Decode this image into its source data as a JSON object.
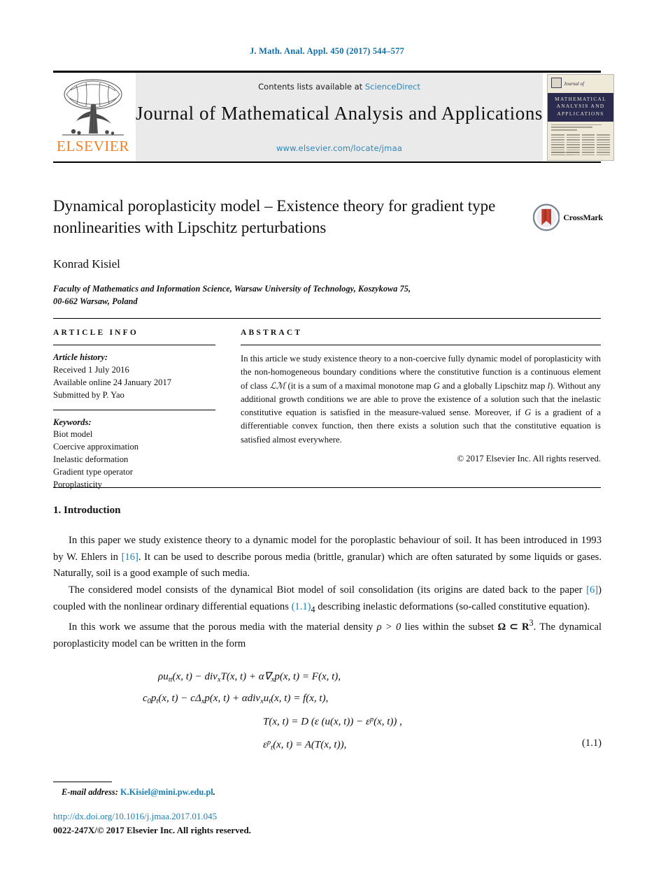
{
  "running_head": "J. Math. Anal. Appl. 450 (2017) 544–577",
  "masthead": {
    "contents_prefix": "Contents lists available at ",
    "sciencedirect": "ScienceDirect",
    "journal_title": "Journal of Mathematical Analysis and Applications",
    "journal_url": "www.elsevier.com/locate/jmaa",
    "publisher_wordmark": "ELSEVIER",
    "cover": {
      "journal_of": "Journal of",
      "band_line1": "MATHEMATICAL",
      "band_line2": "ANALYSIS AND",
      "band_line3": "APPLICATIONS"
    }
  },
  "article": {
    "title": "Dynamical poroplasticity model – Existence theory for gradient type nonlinearities with Lipschitz perturbations",
    "author": "Konrad Kisiel",
    "affiliation_line1": "Faculty of Mathematics and Information Science, Warsaw University of Technology, Koszykowa 75,",
    "affiliation_line2": "00-662 Warsaw, Poland",
    "crossmark_label": "CrossMark"
  },
  "info": {
    "heading": "ARTICLE INFO",
    "history_label": "Article history:",
    "history": [
      "Received 1 July 2016",
      "Available online 24 January 2017",
      "Submitted by P. Yao"
    ],
    "keywords_label": "Keywords:",
    "keywords": [
      "Biot model",
      "Coercive approximation",
      "Inelastic deformation",
      "Gradient type operator",
      "Poroplasticity"
    ]
  },
  "abstract": {
    "heading": "ABSTRACT",
    "part1": "In this article we study existence theory to a non-coercive fully dynamic model of poroplasticity with the non-homogeneous boundary conditions where the constitutive function is a continuous element of class ",
    "class_symbol": "ℒℳ",
    "part2": " (it is a sum of a maximal monotone map ",
    "sym_G": "G",
    "part3": " and a globally Lipschitz map ",
    "sym_l": "l",
    "part4": "). Without any additional growth conditions we are able to prove the existence of a solution such that the inelastic constitutive equation is satisfied in the measure-valued sense. Moreover, if ",
    "sym_G2": "G",
    "part5": " is a gradient of a differentiable convex function, then there exists a solution such that the constitutive equation is satisfied almost everywhere.",
    "copyright": "© 2017 Elsevier Inc. All rights reserved."
  },
  "body": {
    "section_number_title": "1. Introduction",
    "p1_a": "In this paper we study existence theory to a dynamic model for the poroplastic behaviour of soil. It has been introduced in 1993 by W. Ehlers in ",
    "p1_ref": "[16]",
    "p1_b": ". It can be used to describe porous media (brittle, granular) which are often saturated by some liquids or gases. Naturally, soil is a good example of such media.",
    "p2_a": "The considered model consists of the dynamical Biot model of soil consolidation (its origins are dated back to the paper ",
    "p2_ref1": "[6]",
    "p2_b": ") coupled with the nonlinear ordinary differential equations ",
    "p2_ref2": "(1.1)",
    "p2_ref2sub": "4",
    "p2_c": " describing inelastic deformations (so-called constitutive equation).",
    "p3_a": "In this work we assume that the porous media with the material density ",
    "p3_rho": "ρ > 0",
    "p3_b": " lies within the subset ",
    "p3_omega": "Ω ⊂ R",
    "p3_omega_sup": "3",
    "p3_c": ". The dynamical poroplasticity model can be written in the form"
  },
  "equations": {
    "number": "(1.1)",
    "line1": "ρu",
    "line1_sub": "tt",
    "line1_b": "(x, t) − div",
    "line1_sub2": "x",
    "line1_c": "T(x, t) + α∇",
    "line1_sub3": "x",
    "line1_d": "p(x, t) = F(x, t),",
    "line2": "c",
    "line2_sub": "0",
    "line2_b": "p",
    "line2_sub2": "t",
    "line2_c": "(x, t) − cΔ",
    "line2_sub3": "x",
    "line2_d": "p(x, t) + αdiv",
    "line2_sub4": "x",
    "line2_e": "u",
    "line2_sub5": "t",
    "line2_f": "(x, t) = f(x, t),",
    "line3": "T(x, t) = D (ε (u(x, t)) − ε",
    "line3_sup": "p",
    "line3_b": "(x, t)) ,",
    "line4": "ε",
    "line4_sup": "p",
    "line4_sub": "t",
    "line4_b": "(x, t) = A(T(x, t)),"
  },
  "footer": {
    "email_label": "E-mail address:",
    "email": "K.Kisiel@mini.pw.edu.pl",
    "email_period": ".",
    "doi": "http://dx.doi.org/10.1016/j.jmaa.2017.01.045",
    "issn": "0022-247X/© 2017 Elsevier Inc. All rights reserved."
  },
  "colors": {
    "link_blue": "#1a7fb5",
    "header_blue": "#0f6ea8",
    "elsevier_orange": "#f08024",
    "cover_band": "#2b2b50",
    "gray_box": "#eaeaea"
  }
}
